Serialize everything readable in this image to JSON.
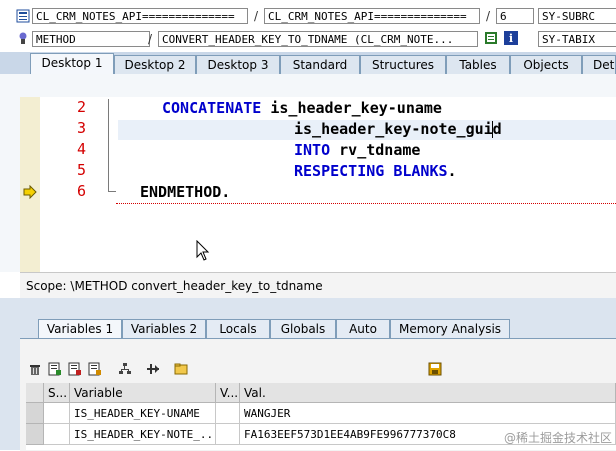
{
  "toolbar": {
    "row1": {
      "field1": "CL_CRM_NOTES_API==============",
      "sep1": "/",
      "field2": "CL_CRM_NOTES_API==============",
      "sep2": "/",
      "field3": "6",
      "sysfield": "SY-SUBRC"
    },
    "row2": {
      "field1": "METHOD",
      "sep1": "/",
      "field2": "CONVERT_HEADER_KEY_TO_TDNAME (CL_CRM_NOTE...",
      "sysfield": "SY-TABIX"
    }
  },
  "desktop_tabs": [
    {
      "label": "Desktop 1",
      "active": true
    },
    {
      "label": "Desktop 2",
      "active": false
    },
    {
      "label": "Desktop 3",
      "active": false
    },
    {
      "label": "Standard",
      "active": false
    },
    {
      "label": "Structures",
      "active": false
    },
    {
      "label": "Tables",
      "active": false
    },
    {
      "label": "Objects",
      "active": false
    },
    {
      "label": "Det",
      "active": false
    }
  ],
  "editor": {
    "lines": [
      {
        "num": "2",
        "parts": [
          [
            "kw",
            "CONCATENATE"
          ],
          [
            "id",
            " is_header_key-uname"
          ]
        ]
      },
      {
        "num": "3",
        "parts": [
          [
            "id",
            "is_header_key-note_guid"
          ]
        ]
      },
      {
        "num": "4",
        "parts": [
          [
            "kw",
            "INTO"
          ],
          [
            "id",
            " rv_tdname"
          ]
        ]
      },
      {
        "num": "5",
        "parts": [
          [
            "kw",
            "RESPECTING BLANKS"
          ],
          [
            "id",
            "."
          ]
        ]
      },
      {
        "num": "6",
        "parts": [
          [
            "id",
            "ENDMETHOD."
          ]
        ]
      }
    ],
    "current_line": "6"
  },
  "scope": "Scope: \\METHOD convert_header_key_to_tdname",
  "variable_tabs": [
    {
      "label": "Variables 1",
      "active": true
    },
    {
      "label": "Variables 2",
      "active": false
    },
    {
      "label": "Locals",
      "active": false
    },
    {
      "label": "Globals",
      "active": false
    },
    {
      "label": "Auto",
      "active": false
    },
    {
      "label": "Memory Analysis",
      "active": false
    }
  ],
  "variables_table": {
    "headers": [
      "S...",
      "Variable",
      "V...",
      "Val."
    ],
    "rows": [
      {
        "variable": "IS_HEADER_KEY-UNAME",
        "value": "WANGJER"
      },
      {
        "variable": "IS_HEADER_KEY-NOTE_...",
        "value": "FA163EEF573D1EE4AB9FE996777370C8"
      }
    ]
  },
  "watermark": "@稀土掘金技术社区",
  "colors": {
    "keyword": "#0000cc",
    "line_number": "#d40000",
    "tab_bar": "#c9d7e8"
  }
}
